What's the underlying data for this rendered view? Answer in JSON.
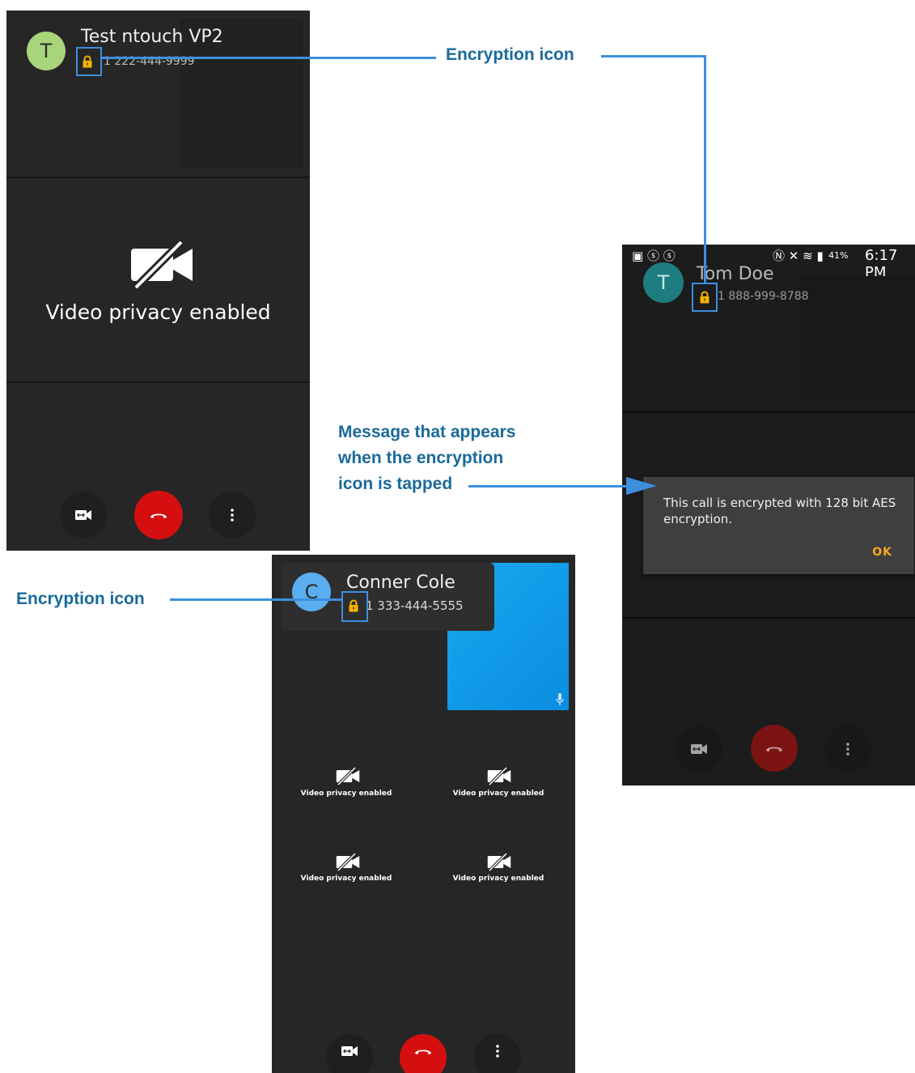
{
  "annotations": {
    "encryption_icon_top": "Encryption icon",
    "encryption_icon_left": "Encryption icon",
    "message_note": [
      "Message that appears",
      "when the encryption",
      "icon is tapped"
    ]
  },
  "screen1": {
    "avatar_letter": "T",
    "contact_name": "Test ntouch VP2",
    "contact_number": "1 222-444-9999",
    "privacy_text": "Video privacy enabled",
    "avatar_color": "#a8d47c"
  },
  "screen2": {
    "status_bar": {
      "battery": "41%",
      "time": "6:17 PM"
    },
    "avatar_letter": "T",
    "contact_name": "Tom Doe",
    "contact_number": "1 888-999-8788",
    "avatar_color": "#1e7d80",
    "dialog": {
      "message": "This call is encrypted with 128 bit AES encryption.",
      "ok_label": "OK"
    }
  },
  "screen3": {
    "avatar_letter": "C",
    "contact_name": "Conner Cole",
    "contact_number": "1 333-444-5555",
    "avatar_color": "#5aaef0",
    "tiles": [
      "Video privacy enabled",
      "Video privacy enabled",
      "Video privacy enabled",
      "Video privacy enabled"
    ]
  },
  "colors": {
    "accent_blue": "#3d8fe0",
    "lock_yellow": "#f5b400",
    "hangup_red": "#d50f0f",
    "ok_orange": "#f3a81e"
  }
}
